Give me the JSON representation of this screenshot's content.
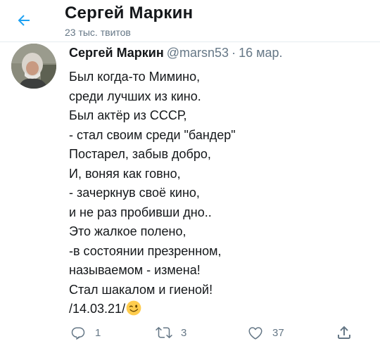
{
  "header": {
    "title": "Сергей Маркин",
    "subtitle": "23 тыс. твитов"
  },
  "tweet": {
    "author_name": "Сергей Маркин",
    "author_handle": "@marsn53",
    "separator": "·",
    "date": "16 мар.",
    "lines": [
      "Был когда-то Мимино,",
      "среди лучших из кино.",
      "Был актёр из СССР,",
      "- стал своим среди \"бандер\"",
      "Постарел, забыв добро,",
      "И, воняя как говно,",
      "- зачеркнув своё кино,",
      "и не раз пробивши дно..",
      "Это жалкое полено,",
      "-в состоянии презренном,",
      "называемом - измена!",
      "Стал шакалом и гиеной!",
      "/14.03.21/"
    ],
    "trailing_emoji": "winking-face-icon"
  },
  "actions": {
    "reply_count": "1",
    "retweet_count": "3",
    "like_count": "37"
  },
  "colors": {
    "accent": "#1da1f2",
    "text": "#14171a",
    "secondary": "#657786",
    "divider": "#e6ecf0"
  }
}
